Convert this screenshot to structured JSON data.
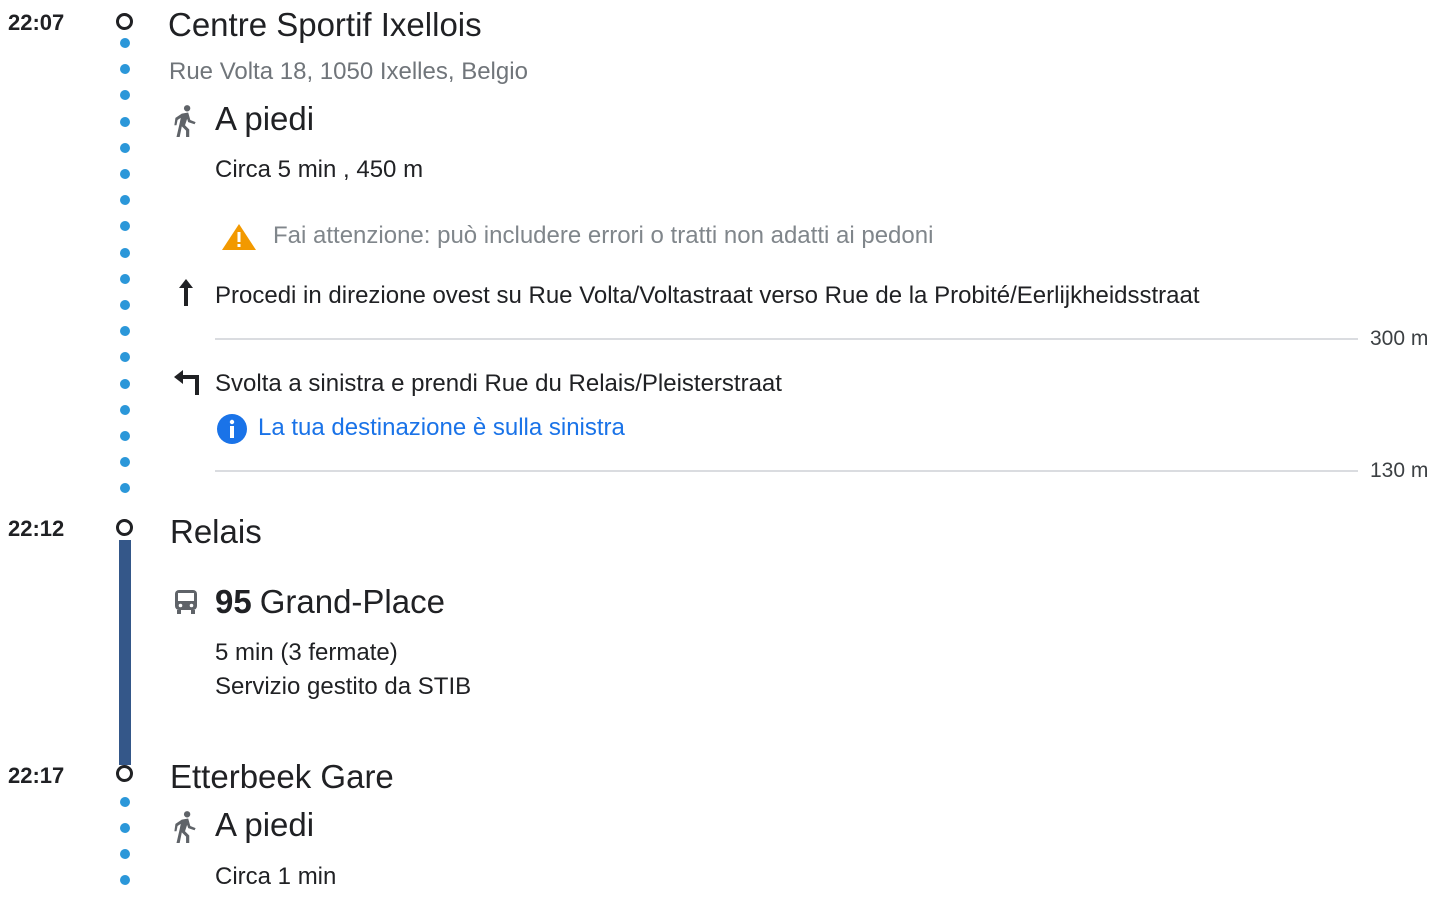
{
  "stops": [
    {
      "time": "22:07",
      "name": "Centre Sportif Ixellois",
      "address": "Rue Volta 18, 1050 Ixelles, Belgio"
    },
    {
      "time": "22:12",
      "name": "Relais"
    },
    {
      "time": "22:17",
      "name": "Etterbeek Gare"
    }
  ],
  "walk1": {
    "mode_icon": "walking-icon",
    "label": "A piedi",
    "duration": "Circa 5 min , 450 m",
    "warning": "Fai attenzione: può includere errori o tratti non adatti ai pedoni",
    "steps": [
      {
        "icon": "arrow-up-icon",
        "text": "Procedi in direzione ovest su Rue Volta/Voltastraat verso Rue de la Probité/Eerlijkheidsstraat",
        "distance": "300 m"
      },
      {
        "icon": "turn-left-icon",
        "text": "Svolta a sinistra e prendi Rue du Relais/Pleisterstraat",
        "note": "La tua destinazione è sulla sinistra",
        "distance": "130 m"
      }
    ]
  },
  "bus": {
    "mode_icon": "bus-icon",
    "route": "95",
    "headsign": "Grand-Place",
    "duration": "5 min (3 fermate)",
    "operator": "Servizio gestito da STIB",
    "line_color": "#345789"
  },
  "walk2": {
    "mode_icon": "walking-icon",
    "label": "A piedi",
    "duration": "Circa 1 min"
  },
  "colors": {
    "walk_dots": "#2b97d9",
    "info_link": "#1a73e8",
    "warning": "#f29900"
  }
}
